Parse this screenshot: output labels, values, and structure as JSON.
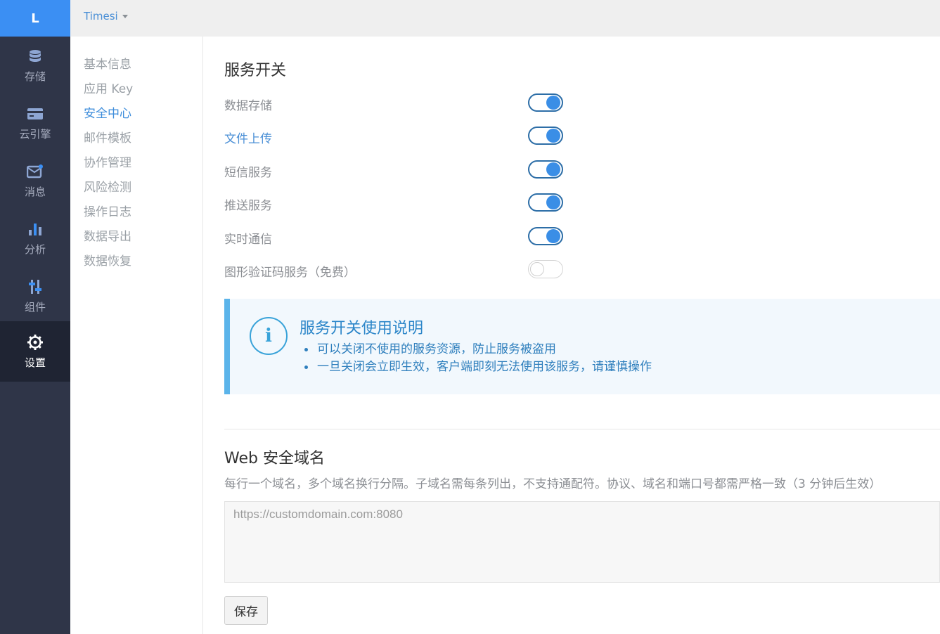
{
  "rail": {
    "logo": "L",
    "items": [
      {
        "label": "存储",
        "icon": "database-icon"
      },
      {
        "label": "云引擎",
        "icon": "card-icon"
      },
      {
        "label": "消息",
        "icon": "message-icon"
      },
      {
        "label": "分析",
        "icon": "bar-chart-icon"
      },
      {
        "label": "组件",
        "icon": "sliders-icon"
      },
      {
        "label": "设置",
        "icon": "gear-icon",
        "active": true
      }
    ]
  },
  "topbar": {
    "app_name": "Timesi"
  },
  "subnav": {
    "items": [
      "基本信息",
      "应用 Key",
      "安全中心",
      "邮件模板",
      "协作管理",
      "风险检测",
      "操作日志",
      "数据导出",
      "数据恢复"
    ],
    "active": "安全中心"
  },
  "services": {
    "title": "服务开关",
    "items": [
      {
        "label": "数据存储",
        "enabled": true
      },
      {
        "label": "文件上传",
        "enabled": true
      },
      {
        "label": "短信服务",
        "enabled": true
      },
      {
        "label": "推送服务",
        "enabled": true
      },
      {
        "label": "实时通信",
        "enabled": true
      },
      {
        "label": "图形验证码服务（免费）",
        "enabled": false
      }
    ]
  },
  "info": {
    "icon": "info-icon",
    "title": "服务开关使用说明",
    "bullets": [
      "可以关闭不使用的服务资源，防止服务被盗用",
      "一旦关闭会立即生效，客户端即刻无法使用该服务，请谨慎操作"
    ]
  },
  "web": {
    "title": "Web 安全域名",
    "description": "每行一个域名，多个域名换行分隔。子域名需每条列出，不支持通配符。协议、域名和端口号都需严格一致（3 分钟后生效）",
    "placeholder": "https://customdomain.com:8080",
    "save_label": "保存"
  },
  "colors": {
    "accent": "#3b8ff3",
    "rail_bg": "#2f3548",
    "toggle_on": "#3a8ee6",
    "info_bg": "#f2f8fd"
  }
}
